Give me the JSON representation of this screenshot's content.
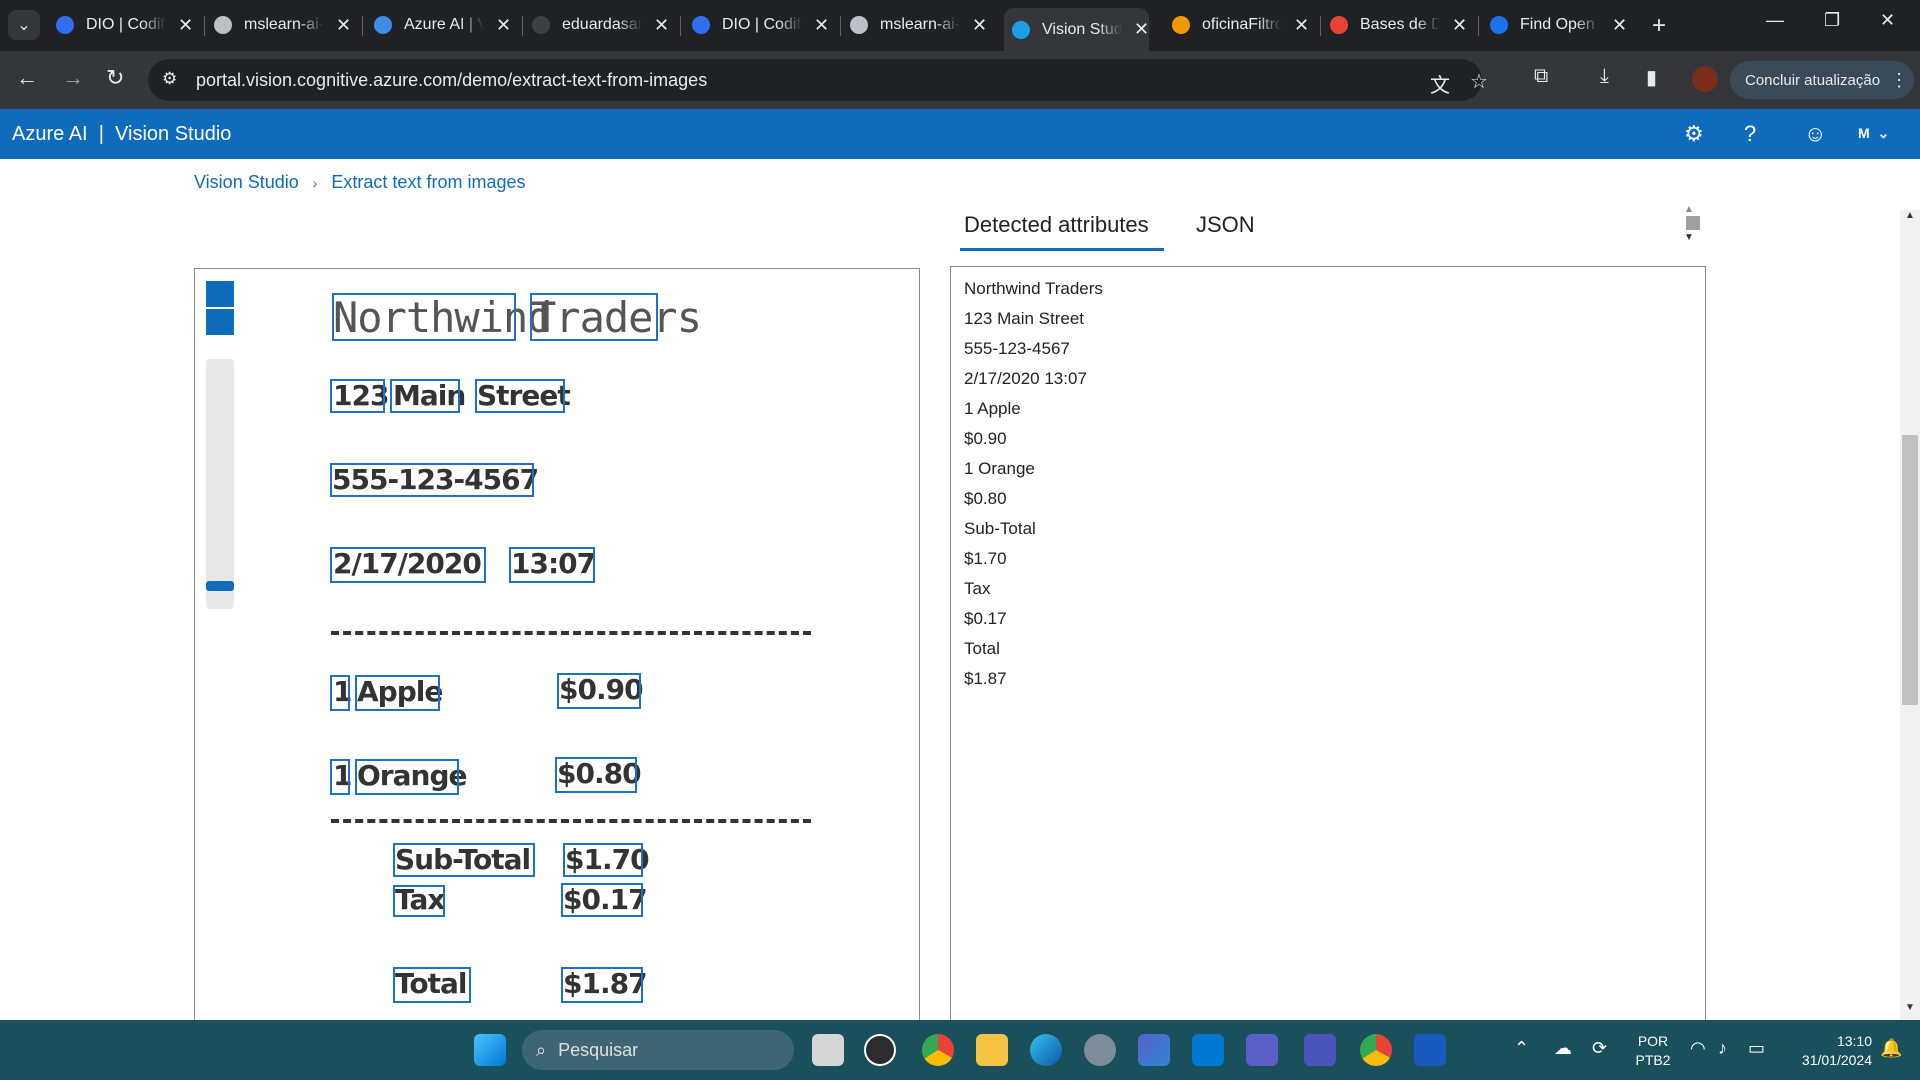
{
  "browser": {
    "tabs": [
      {
        "title": "DIO | Codifique o seu futuro",
        "color": "#2f6fef"
      },
      {
        "title": "mslearn-ai-vision",
        "color": "#bdc1c6"
      },
      {
        "title": "Azure AI | Vision Studio",
        "color": "#3b8de6"
      },
      {
        "title": "eduardasantos",
        "color": "#3c4043"
      },
      {
        "title": "DIO | Codifique o seu futuro",
        "color": "#2f6fef"
      },
      {
        "title": "mslearn-ai-vision",
        "color": "#bdc1c6"
      },
      {
        "title": "Vision Studio",
        "color": "#1aa0e6"
      },
      {
        "title": "oficinaFiltros",
        "color": "#f29900"
      },
      {
        "title": "Bases de Dados",
        "color": "#e94235"
      },
      {
        "title": "Find Open Datasets",
        "color": "#1a73e8"
      }
    ],
    "url": "portal.vision.cognitive.azure.com/demo/extract-text-from-images",
    "update_button": "Concluir atualização"
  },
  "app": {
    "brand": "Azure AI",
    "product": "Vision Studio",
    "user_initial": "M"
  },
  "breadcrumb": {
    "root": "Vision Studio",
    "current": "Extract text from images"
  },
  "panel_tabs": {
    "detected": "Detected attributes",
    "json": "JSON"
  },
  "receipt": {
    "title_words": [
      "Northwind",
      "Traders"
    ],
    "street_words": [
      "123",
      "Main",
      "Street"
    ],
    "phone": "555-123-4567",
    "date": "2/17/2020",
    "time": "13:07",
    "item1_qty": "1",
    "item1_name": "Apple",
    "item1_price": "$0.90",
    "item2_qty": "1",
    "item2_name": "Orange",
    "item2_price": "$0.80",
    "subtotal_label": "Sub-Total",
    "subtotal_value": "$1.70",
    "tax_label": "Tax",
    "tax_value": "$0.17",
    "total_label": "Total",
    "total_value": "$1.87"
  },
  "detected_lines": [
    "Northwind Traders",
    "123 Main Street",
    "555-123-4567",
    "2/17/2020 13:07",
    "1 Apple",
    "$0.90",
    "1 Orange",
    "$0.80",
    "Sub-Total",
    "$1.70",
    "Tax",
    "$0.17",
    "Total",
    "$1.87"
  ],
  "taskbar": {
    "search_placeholder": "Pesquisar",
    "lang_top": "POR",
    "lang_bottom": "PTB2",
    "time": "13:10",
    "date": "31/01/2024"
  }
}
